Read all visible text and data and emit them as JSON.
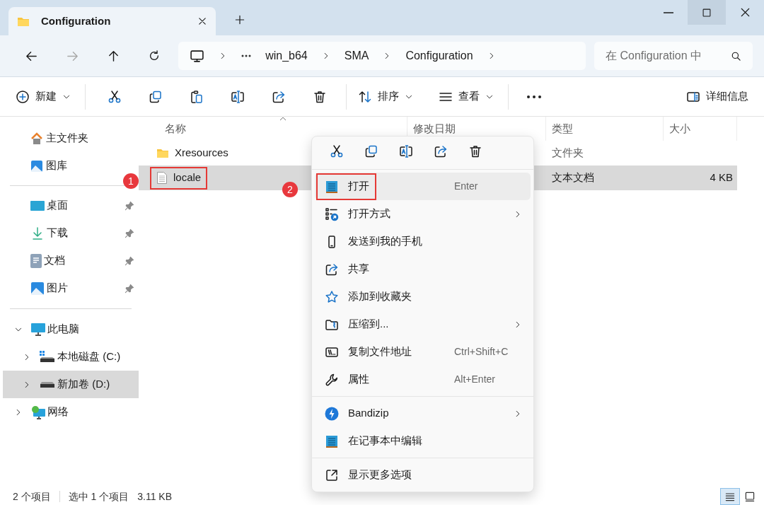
{
  "window": {
    "tab_title": "Configuration"
  },
  "breadcrumb": [
    "win_b64",
    "SMA",
    "Configuration"
  ],
  "search": {
    "placeholder": "在 Configuration 中"
  },
  "toolbar": {
    "new": "新建",
    "sort": "排序",
    "view": "查看",
    "details": "详细信息"
  },
  "sidebar": {
    "quick": [
      {
        "label": "主文件夹"
      },
      {
        "label": "图库"
      }
    ],
    "pinned": [
      {
        "label": "桌面",
        "pinned": true
      },
      {
        "label": "下载",
        "pinned": true
      },
      {
        "label": "文档",
        "pinned": true
      },
      {
        "label": "图片",
        "pinned": true
      }
    ],
    "tree": [
      {
        "label": "此电脑",
        "expanded": true,
        "selected": false,
        "children": [
          {
            "label": "本地磁盘 (C:)",
            "expanded": false,
            "selected": false
          },
          {
            "label": "新加卷 (D:)",
            "expanded": false,
            "selected": true
          }
        ]
      },
      {
        "label": "网络",
        "expanded": false,
        "selected": false
      }
    ]
  },
  "columns": [
    "名称",
    "修改日期",
    "类型",
    "大小"
  ],
  "files": [
    {
      "kind": "folder",
      "name": "Xresources",
      "type": "文件夹",
      "selected": false,
      "outlined": false
    },
    {
      "kind": "file",
      "name": "locale",
      "type": "文本文档",
      "size": "4 KB",
      "selected": true,
      "outlined": true
    }
  ],
  "context_menu": {
    "groups": [
      [
        {
          "label": "打开",
          "shortcut": "Enter",
          "submenu": false,
          "selected": true,
          "outlined": true
        },
        {
          "label": "打开方式",
          "submenu": true,
          "selected": false,
          "outlined": false
        },
        {
          "label": "发送到我的手机",
          "submenu": false,
          "selected": false,
          "outlined": false
        },
        {
          "label": "共享",
          "submenu": false,
          "selected": false,
          "outlined": false
        },
        {
          "label": "添加到收藏夹",
          "submenu": false,
          "selected": false,
          "outlined": false
        },
        {
          "label": "压缩到...",
          "submenu": true,
          "selected": false,
          "outlined": false
        },
        {
          "label": "复制文件地址",
          "shortcut": "Ctrl+Shift+C",
          "submenu": false,
          "selected": false,
          "outlined": false
        },
        {
          "label": "属性",
          "shortcut": "Alt+Enter",
          "submenu": false,
          "selected": false,
          "outlined": false
        }
      ],
      [
        {
          "label": "Bandizip",
          "submenu": true,
          "selected": false,
          "outlined": false
        },
        {
          "label": "在记事本中编辑",
          "submenu": false,
          "selected": false,
          "outlined": false
        }
      ],
      [
        {
          "label": "显示更多选项",
          "submenu": false,
          "selected": false,
          "outlined": false
        }
      ]
    ]
  },
  "annotations": [
    "1",
    "2"
  ],
  "status_bar": {
    "count": "2 个项目",
    "selection": "选中 1 个项目",
    "size": "3.11 KB"
  },
  "view_modes": [
    {
      "selected": true
    },
    {
      "selected": false
    }
  ]
}
